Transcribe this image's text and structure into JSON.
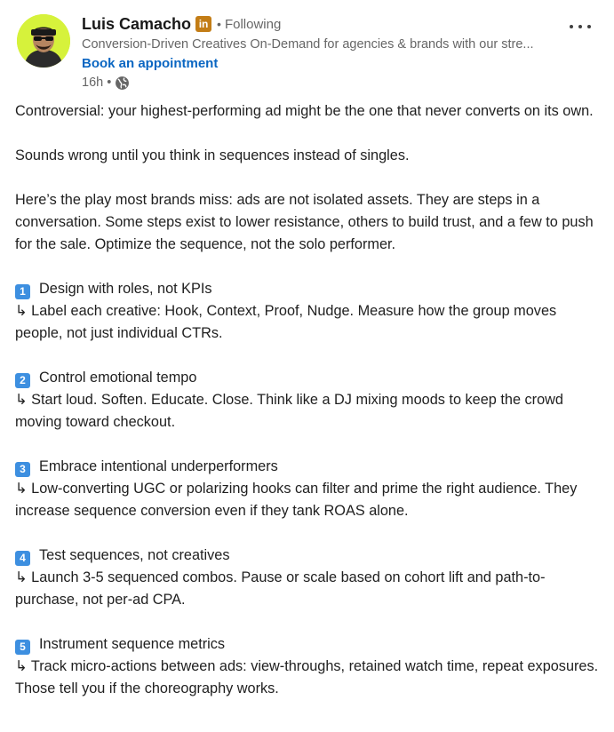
{
  "author": {
    "name": "Luis Camacho",
    "badge": "in",
    "separator": "•",
    "following": "Following",
    "headline": "Conversion-Driven Creatives On-Demand for agencies & brands with our stre...",
    "cta": "Book an appointment",
    "time": "16h",
    "time_separator": "•"
  },
  "post": {
    "intro_1": "Controversial: your highest-performing ad might be the one that never converts on its own.",
    "intro_2": "Sounds wrong until you think in sequences instead of singles.",
    "intro_3": "Here’s the play most brands miss: ads are not isolated assets. They are steps in a conversation. Some steps exist to lower resistance, others to build trust, and a few to push for the sale. Optimize the sequence, not the solo performer.",
    "items": [
      {
        "num": "1",
        "title": "Design with roles, not KPIs",
        "body": "↳ Label each creative: Hook, Context, Proof, Nudge. Measure how the group moves people, not just individual CTRs."
      },
      {
        "num": "2",
        "title": "Control emotional tempo",
        "body": "↳ Start loud. Soften. Educate. Close. Think like a DJ mixing moods to keep the crowd moving toward checkout."
      },
      {
        "num": "3",
        "title": "Embrace intentional underperformers",
        "body": "↳ Low-converting UGC or polarizing hooks can filter and prime the right audience. They increase sequence conversion even if they tank ROAS alone."
      },
      {
        "num": "4",
        "title": "Test sequences, not creatives",
        "body": "↳ Launch 3-5 sequenced combos. Pause or scale based on cohort lift and path-to-purchase, not per-ad CPA."
      },
      {
        "num": "5",
        "title": "Instrument sequence metrics",
        "body": "↳ Track micro-actions between ads: view-throughs, retained watch time, repeat exposures. Those tell you if the choreography works."
      }
    ]
  },
  "colors": {
    "avatar_bg": "#d6f23b",
    "link": "#0a66c2",
    "badge": "#c37d16",
    "keycap": "#3d8fe0"
  },
  "icons": {
    "more": "more-horizontal-icon",
    "visibility": "globe-icon"
  }
}
